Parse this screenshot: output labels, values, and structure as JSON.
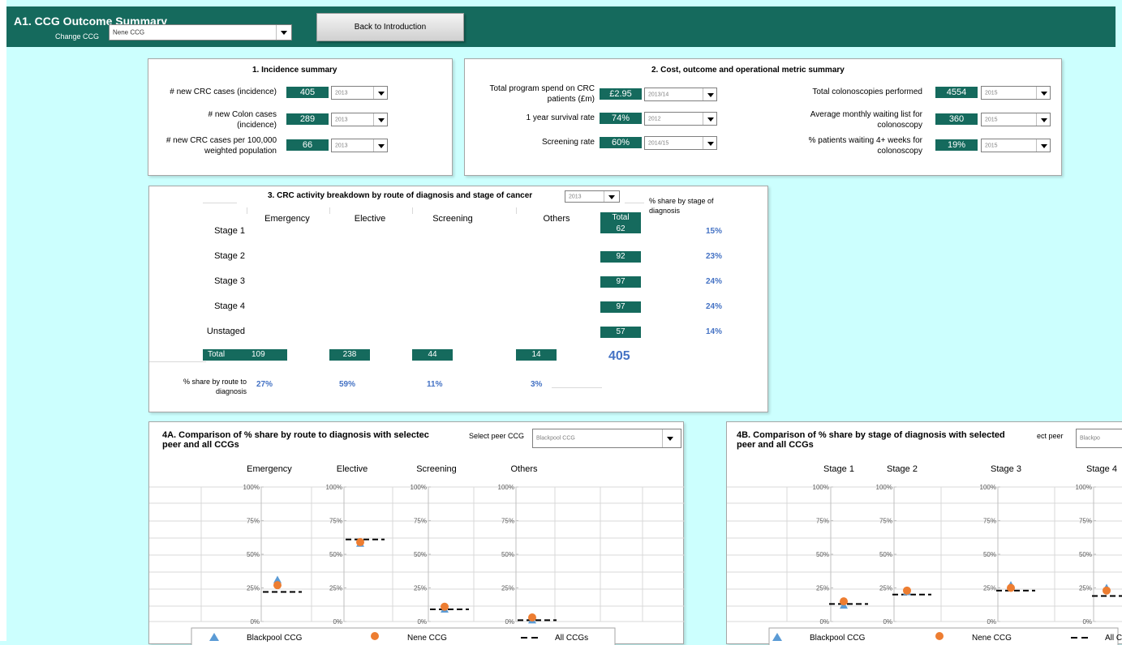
{
  "header": {
    "title": "A1. CCG Outcome Summary",
    "change_label": "Change CCG",
    "ccg_selected": "Nene CCG",
    "back_button": "Back to Introduction"
  },
  "incidence": {
    "title": "1. Incidence summary",
    "rows": [
      {
        "label_1": "# new CRC cases (incidence)",
        "label_2": "",
        "value": "405",
        "year": "2013"
      },
      {
        "label_1": "# new Colon cases",
        "label_2": "(incidence)",
        "value": "289",
        "year": "2013"
      },
      {
        "label_1": "# new CRC cases per 100,000",
        "label_2": "weighted population",
        "value": "66",
        "year": "2013"
      }
    ]
  },
  "cost": {
    "title": "2. Cost, outcome and operational metric summary",
    "left_rows": [
      {
        "label_1": "Total program spend on CRC",
        "label_2": "patients (£m)",
        "value": "£2.95",
        "year": "2013/14"
      },
      {
        "label_1": "1 year survival rate",
        "label_2": "",
        "value": "74%",
        "year": "2012"
      },
      {
        "label_1": "Screening rate",
        "label_2": "",
        "value": "60%",
        "year": "2014/15"
      }
    ],
    "right_rows": [
      {
        "label_1": "Total colonoscopies performed",
        "label_2": "",
        "value": "4554",
        "year": "2015"
      },
      {
        "label_1": "Average monthly waiting list for",
        "label_2": "colonoscopy",
        "value": "360",
        "year": "2015"
      },
      {
        "label_1": "% patients waiting 4+ weeks for",
        "label_2": "colonoscopy",
        "value": "19%",
        "year": "2015"
      }
    ]
  },
  "activity": {
    "title": "3. CRC activity breakdown by route of diagnosis and stage of cancer",
    "year": "2013",
    "share_stage_title_1": "% share by stage of",
    "share_stage_title_2": "diagnosis",
    "columns": [
      "Emergency",
      "Elective",
      "Screening",
      "Others"
    ],
    "total_header": "Total",
    "stages": [
      {
        "name": "Stage 1",
        "total": "62",
        "share": "15%"
      },
      {
        "name": "Stage 2",
        "total": "92",
        "share": "23%"
      },
      {
        "name": "Stage 3",
        "total": "97",
        "share": "24%"
      },
      {
        "name": "Stage 4",
        "total": "97",
        "share": "24%"
      },
      {
        "name": "Unstaged",
        "total": "57",
        "share": "14%"
      }
    ],
    "total_row_label": "Total",
    "route_totals": [
      "109",
      "238",
      "44",
      "14"
    ],
    "grand_total": "405",
    "route_share_label_1": "% share by route to",
    "route_share_label_2": "diagnosis",
    "route_shares": [
      "27%",
      "59%",
      "11%",
      "3%"
    ]
  },
  "compare_route": {
    "title_1": "4A. Comparison of % share by route to diagnosis with selectec",
    "title_2": "peer and all CCGs",
    "select_label": "Select peer CCG",
    "peer_selected": "Blackpool CCG",
    "subplots": [
      "Emergency",
      "Elective",
      "Screening",
      "Others"
    ]
  },
  "compare_stage": {
    "title_1": "4B. Comparison of % share by stage of diagnosis with selected",
    "title_2": "peer and all CCGs",
    "select_label": "ect peer",
    "peer_selected": "Blackpo",
    "subplots": [
      "Stage 1",
      "Stage 2",
      "Stage 3",
      "Stage 4"
    ]
  },
  "ticks": [
    "100%",
    "75%",
    "50%",
    "25%",
    "0%"
  ],
  "legend": {
    "peer": "Blackpool CCG",
    "ccg": "Nene CCG",
    "all": "All CCGs"
  },
  "colors": {
    "header": "#156a5d",
    "background": "#ccfffe",
    "peer": "#5b9bd5",
    "ccg": "#ed7d31",
    "pct_text": "#4472c4"
  },
  "chart_data": [
    {
      "type": "scatter",
      "title": "4A. Comparison of % share by route to diagnosis with selected peer and all CCGs",
      "categories": [
        "Emergency",
        "Elective",
        "Screening",
        "Others"
      ],
      "ylim": [
        0,
        100
      ],
      "series": [
        {
          "name": "Blackpool CCG",
          "marker": "triangle",
          "values": [
            31,
            58,
            9,
            1
          ]
        },
        {
          "name": "Nene CCG",
          "marker": "circle",
          "values": [
            27,
            59,
            11,
            3
          ]
        },
        {
          "name": "All CCGs",
          "marker": "dash",
          "values": [
            22,
            61,
            9,
            1
          ]
        }
      ]
    },
    {
      "type": "scatter",
      "title": "4B. Comparison of % share by stage of diagnosis with selected peer and all CCGs",
      "categories": [
        "Stage 1",
        "Stage 2",
        "Stage 3",
        "Stage 4"
      ],
      "ylim": [
        0,
        100
      ],
      "series": [
        {
          "name": "Blackpool CCG",
          "marker": "triangle",
          "values": [
            12,
            22,
            27,
            25
          ]
        },
        {
          "name": "Nene CCG",
          "marker": "circle",
          "values": [
            15,
            23,
            25,
            23
          ]
        },
        {
          "name": "All CCGs",
          "marker": "dash",
          "values": [
            13,
            20,
            23,
            19
          ]
        }
      ]
    }
  ]
}
